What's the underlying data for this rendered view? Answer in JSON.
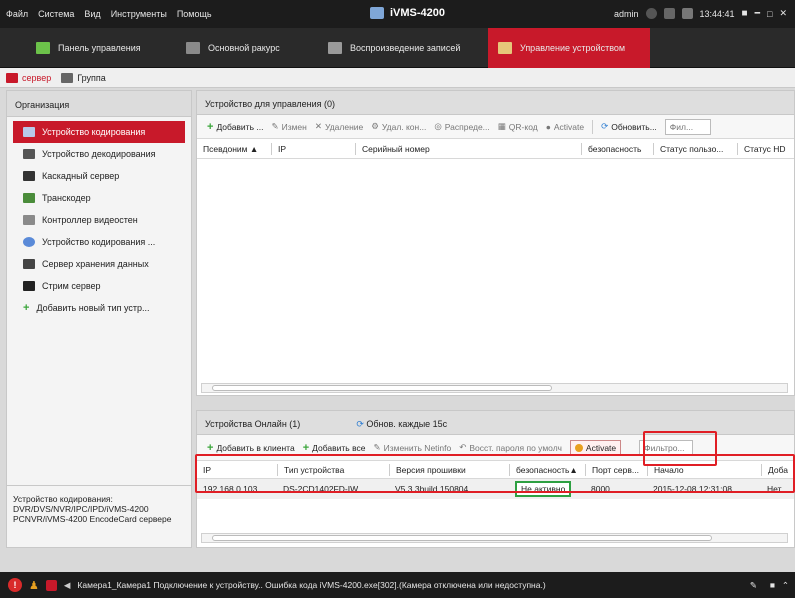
{
  "menubar": {
    "items": [
      "Файл",
      "Система",
      "Вид",
      "Инструменты",
      "Помощь"
    ],
    "app_title": "iVMS-4200",
    "user": "admin",
    "time": "13:44:41"
  },
  "tabs": [
    {
      "label": "Панель управления",
      "icon": "dashboard-icon"
    },
    {
      "label": "Основной ракурс",
      "icon": "main-view-icon"
    },
    {
      "label": "Воспроизведение записей",
      "icon": "playback-icon"
    },
    {
      "label": "Управление устройством",
      "icon": "device-management-icon"
    }
  ],
  "subbar": {
    "server": "сервер",
    "group": "Группа"
  },
  "left": {
    "header": "Организация",
    "items": [
      "Устройство кодирования",
      "Устройство декодирования",
      "Каскадный сервер",
      "Транскодер",
      "Контроллер видеостен",
      "Устройство кодирования ...",
      "Сервер хранения данных",
      "Стрим сервер",
      "Добавить новый тип устр..."
    ],
    "info": "Устройство кодирования: DVR/DVS/NVR/IPC/IPD/iVMS-4200 PCNVR/iVMS-4200 EncodeCard сервере"
  },
  "top_panel": {
    "title": "Устройство для управления (0)",
    "toolbar": {
      "add": "Добавить ...",
      "edit": "Измен",
      "delete": "Удаление",
      "remote": "Удал. кон...",
      "distribute": "Распреде...",
      "qr": "QR-код",
      "activate": "Activate",
      "refresh": "Обновить...",
      "filter_placeholder": "Фил..."
    },
    "columns": [
      "Псевдоним",
      "IP",
      "Серийный номер",
      "безопасность",
      "Статус пользо...",
      "Статус HD"
    ]
  },
  "bottom_panel": {
    "title": "Устройства Онлайн (1)",
    "refresh": "Обнов. каждые 15с",
    "toolbar": {
      "add_client": "Добавить в клиента",
      "add_all": "Добавить все",
      "edit_netinfo": "Изменить Netinfo",
      "reset_password": "Восст. пароля по умолч",
      "activate": "Activate",
      "filter_placeholder": "Фильтро..."
    },
    "columns": [
      "IP",
      "Тип устройства",
      "Версия прошивки",
      "безопасность",
      "Порт серв...",
      "Начало",
      "Доба"
    ],
    "rows": [
      {
        "ip": "192.168.0.103",
        "type": "DS-2CD1402FD-IW",
        "firmware": "V5.3.3build 150804",
        "security": "Не активно",
        "port": "8000",
        "start": "2015-12-08 12:31:08",
        "added": "Нет"
      }
    ]
  },
  "statusbar": {
    "message": "Камера1_Камера1 Подключение к устройству.. Ошибка кода iVMS-4200.exe[302].(Камера отключена или недоступна.)"
  },
  "colors": {
    "accent": "#c8192a",
    "highlight": "#e01e25",
    "inactive_border": "#2ea042"
  }
}
